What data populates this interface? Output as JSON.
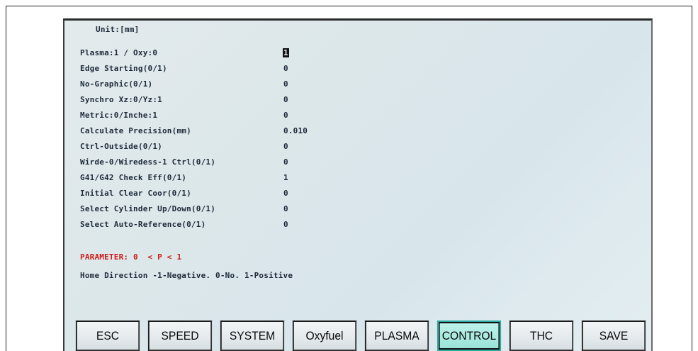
{
  "header": {
    "unit_label": "Unit:[mm]"
  },
  "parameters": [
    {
      "label": "Plasma:1 / Oxy:0",
      "value": "1",
      "selected": true
    },
    {
      "label": "Edge Starting(0/1)",
      "value": "0"
    },
    {
      "label": "No-Graphic(0/1)",
      "value": "0"
    },
    {
      "label": "Synchro Xz:0/Yz:1",
      "value": "0"
    },
    {
      "label": "Metric:0/Inche:1",
      "value": "0"
    },
    {
      "label": "Calculate Precision(mm)",
      "value": "0.010"
    },
    {
      "label": "Ctrl-Outside(0/1)",
      "value": "0"
    },
    {
      "label": "Wirde-0/Wiredess-1 Ctrl(0/1)",
      "value": "0"
    },
    {
      "label": "G41/G42 Check Eff(0/1)",
      "value": "1"
    },
    {
      "label": "Initial Clear Coor(0/1)",
      "value": "0"
    },
    {
      "label": "Select Cylinder Up/Down(0/1)",
      "value": "0"
    },
    {
      "label": "Select Auto-Reference(0/1)",
      "value": "0"
    }
  ],
  "parameter_hint": "PARAMETER: 0  < P < 1",
  "help_text": "Home Direction -1-Negative. 0-No. 1-Positive",
  "softkeys": [
    {
      "label": "ESC"
    },
    {
      "label": "SPEED"
    },
    {
      "label": "SYSTEM"
    },
    {
      "label": "Oxyfuel"
    },
    {
      "label": "PLASMA"
    },
    {
      "label": "CONTROL",
      "active": true
    },
    {
      "label": "THC"
    },
    {
      "label": "SAVE"
    }
  ],
  "colors": {
    "hint_red": "#d01818",
    "active_tab": "#a8eadf",
    "screen_bg": "#dce7ea"
  }
}
